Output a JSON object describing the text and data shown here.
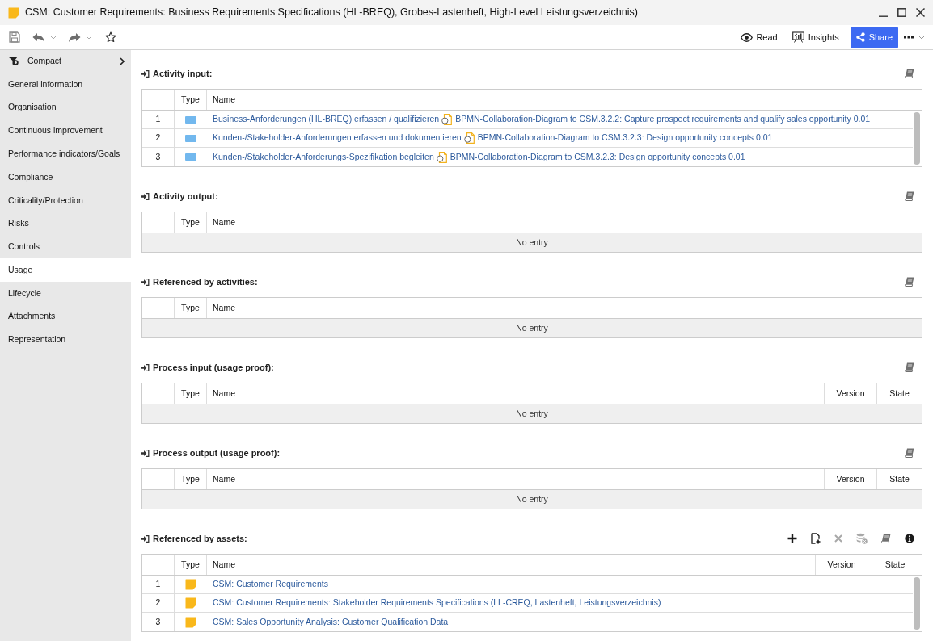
{
  "window": {
    "title": "CSM: Customer Requirements: Business Requirements Specifications (HL-BREQ), Grobes-Lastenheft, High-Level Leistungsverzeichnis)"
  },
  "toolbar": {
    "buttons": [
      {
        "kind": "read",
        "label": "Read"
      },
      {
        "kind": "insights",
        "label": "Insights"
      },
      {
        "kind": "share",
        "label": "Share"
      }
    ]
  },
  "sidebar": {
    "view": {
      "label": "Compact"
    },
    "items": [
      {
        "label": "General information",
        "selected": false
      },
      {
        "label": "Organisation",
        "selected": false
      },
      {
        "label": "Continuous improvement",
        "selected": false
      },
      {
        "label": "Performance indicators/Goals",
        "selected": false
      },
      {
        "label": "Compliance",
        "selected": false
      },
      {
        "label": "Criticality/Protection",
        "selected": false
      },
      {
        "label": "Risks",
        "selected": false
      },
      {
        "label": "Controls",
        "selected": false
      },
      {
        "label": "Usage",
        "selected": true
      },
      {
        "label": "Lifecycle",
        "selected": false
      },
      {
        "label": "Attachments",
        "selected": false
      },
      {
        "label": "Representation",
        "selected": false
      }
    ]
  },
  "sections": [
    {
      "title": "Activity input:",
      "actions": [
        {
          "kind": "book",
          "disabled": false
        }
      ],
      "columns": [
        "Type",
        "Name"
      ],
      "rows": [
        {
          "index": "1",
          "kind": "activity",
          "name": "Business-Anforderungen (HL-BREQ) erfassen / qualifizieren",
          "diagram": "BPMN-Collaboration-Diagram to CSM.3.2.2: Capture prospect requirements and qualify sales opportunity 0.01"
        },
        {
          "index": "2",
          "kind": "activity",
          "name": "Kunden-/Stakeholder-Anforderungen erfassen und dokumentieren",
          "diagram": "BPMN-Collaboration-Diagram to CSM.3.2.3: Design opportunity concepts 0.01"
        },
        {
          "index": "3",
          "kind": "activity",
          "name": "Kunden-/Stakeholder-Anforderungs-Spezifikation begleiten",
          "diagram": "BPMN-Collaboration-Diagram to CSM.3.2.3: Design opportunity concepts 0.01"
        }
      ]
    },
    {
      "title": "Activity output:",
      "actions": [
        {
          "kind": "book",
          "disabled": false
        }
      ],
      "columns": [
        "Type",
        "Name"
      ],
      "empty_text": "No entry"
    },
    {
      "title": "Referenced by activities:",
      "actions": [
        {
          "kind": "book",
          "disabled": false
        }
      ],
      "columns": [
        "Type",
        "Name"
      ],
      "empty_text": "No entry"
    },
    {
      "title": "Process input (usage proof):",
      "actions": [
        {
          "kind": "book",
          "disabled": false
        }
      ],
      "columns": [
        "Type",
        "Name",
        "Version",
        "State"
      ],
      "empty_text": "No entry"
    },
    {
      "title": "Process output (usage proof):",
      "actions": [
        {
          "kind": "book",
          "disabled": false
        }
      ],
      "columns": [
        "Type",
        "Name",
        "Version",
        "State"
      ],
      "empty_text": "No entry"
    },
    {
      "title": "Referenced by assets:",
      "actions": [
        {
          "kind": "add",
          "disabled": false
        },
        {
          "kind": "new-document",
          "disabled": false
        },
        {
          "kind": "remove",
          "disabled": true
        },
        {
          "kind": "database-remove",
          "disabled": true
        },
        {
          "kind": "book",
          "disabled": false
        },
        {
          "kind": "info",
          "disabled": false
        }
      ],
      "columns": [
        "Type",
        "Name",
        "Version",
        "State"
      ],
      "rows": [
        {
          "index": "1",
          "kind": "asset",
          "name": "CSM: Customer Requirements"
        },
        {
          "index": "2",
          "kind": "asset",
          "name": "CSM: Customer Requirements: Stakeholder Requirements Specifications (LL-CREQ, Lastenheft, Leistungsverzeichnis)"
        },
        {
          "index": "3",
          "kind": "asset",
          "name": "CSM: Sales Opportunity Analysis: Customer Qualification Data"
        }
      ]
    }
  ]
}
